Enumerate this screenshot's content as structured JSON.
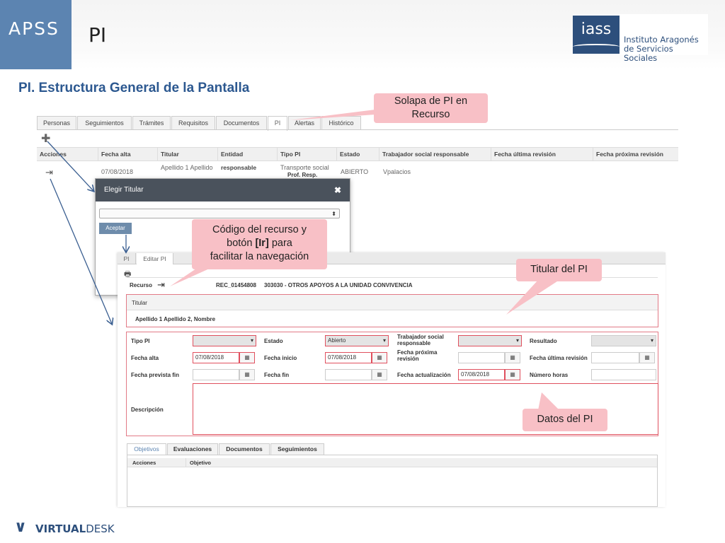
{
  "header": {
    "brand": "APSS",
    "title": "PI",
    "logo_mark": "iass",
    "logo_name_line1": "Instituto Aragonés",
    "logo_name_line2": "de Servicios Sociales"
  },
  "slide_title": "PI. Estructura General de la Pantalla",
  "callouts": {
    "solapa": "Solapa de PI en Recurso",
    "codigo_line1": "Código del recurso y",
    "codigo_line2_pre": "botón ",
    "codigo_line2_bold": "[Ir]",
    "codigo_line2_post": " para",
    "codigo_line3": "facilitar la navegación",
    "titular": "Titular del PI",
    "datos": "Datos del PI"
  },
  "main_tabs": [
    "Personas",
    "Seguimientos",
    "Trámites",
    "Requisitos",
    "Documentos",
    "PI",
    "Alertas",
    "Histórico"
  ],
  "grid": {
    "columns": [
      "Acciones",
      "Fecha alta",
      "Titular",
      "Entidad responsable",
      "Tipo PI",
      "Estado",
      "Trabajador social responsable",
      "Fecha última revisión",
      "Fecha próxima revisión"
    ],
    "row": {
      "fecha_alta": "07/08/2018",
      "titular": "Apellido 1 Apellido",
      "tipo_pi_line1": "Transporte social",
      "tipo_pi_line2": "Prof. Resp.",
      "estado": "ABIERTO",
      "trabajador": "Vpalacios"
    }
  },
  "modal": {
    "title": "Elegir Titular",
    "close": "✖",
    "select_arrow": "⬍",
    "accept": "Aceptar"
  },
  "panel": {
    "tabs": [
      "PI",
      "Editar PI"
    ],
    "recurso_label": "Recurso",
    "recurso_code": "REC_01454808",
    "recurso_desc": "303030 - OTROS APOYOS A LA UNIDAD CONVIVENCIA",
    "titular_label": "Titular",
    "titular_value": "Apellido 1 Apellido 2, Nombre",
    "fields": {
      "tipo_pi": "Tipo PI",
      "estado": "Estado",
      "estado_value": "Abierto",
      "trabajador_line1": "Trabajador social",
      "trabajador_line2": "responsable",
      "resultado": "Resultado",
      "fecha_alta": "Fecha alta",
      "fecha_alta_value": "07/08/2018",
      "fecha_inicio": "Fecha inicio",
      "fecha_inicio_value": "07/08/2018",
      "fecha_proxima_line1": "Fecha próxima",
      "fecha_proxima_line2": "revisión",
      "fecha_ultima": "Fecha última revisión",
      "fecha_prevista": "Fecha prevista fin",
      "fecha_fin": "Fecha fin",
      "fecha_actualizacion": "Fecha actualización",
      "fecha_actualizacion_value": "07/08/2018",
      "numero_horas": "Número horas",
      "descripcion": "Descripción"
    },
    "subtabs": [
      "Objetivos",
      "Evaluaciones",
      "Documentos",
      "Seguimientos"
    ],
    "subgrid_columns": [
      "Acciones",
      "Objetivo"
    ]
  },
  "footer": {
    "brand_bold": "VIRTUAL",
    "brand_thin": "DESK"
  }
}
